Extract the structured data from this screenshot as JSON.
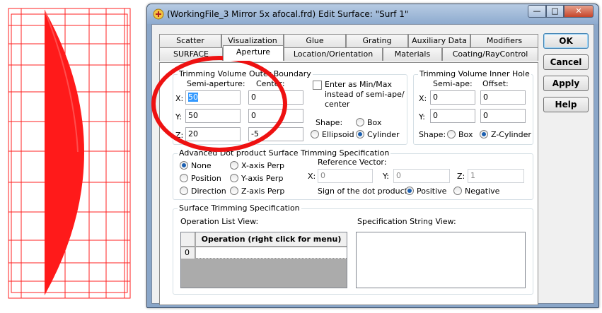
{
  "window": {
    "title": "(WorkingFile_3 Mirror 5x afocal.frd) Edit Surface: \"Surf 1\"",
    "minimize_glyph": "—",
    "maximize_glyph": "□",
    "close_glyph": "✕"
  },
  "tabs": {
    "row1": [
      "Scatter",
      "Visualization",
      "Glue",
      "Grating",
      "Auxiliary Data",
      "Modifiers"
    ],
    "row2": [
      "SURFACE",
      "Aperture",
      "Location/Orientation",
      "Materials",
      "Coating/RayControl"
    ],
    "active": "Aperture"
  },
  "outer": {
    "title": "Trimming Volume Outer Boundary",
    "semi_aperture_label": "Semi-aperture:",
    "center_label": "Center:",
    "axes": [
      {
        "axis": "X:",
        "semi": "50",
        "center": "0"
      },
      {
        "axis": "Y:",
        "semi": "50",
        "center": "0"
      },
      {
        "axis": "Z:",
        "semi": "20",
        "center": "-5"
      }
    ],
    "minmax_line1": "Enter as Min/Max",
    "minmax_line2": "instead of semi-ape/",
    "minmax_line3": "center",
    "shape_label": "Shape:",
    "shape_box": "Box",
    "shape_ellipsoid": "Ellipsoid",
    "shape_cylinder": "Cylinder",
    "shape_selected": "Cylinder"
  },
  "inner": {
    "title": "Trimming Volume Inner Hole",
    "semi_label": "Semi-ape:",
    "offset_label": "Offset:",
    "axes": [
      {
        "axis": "X:",
        "semi": "0",
        "offset": "0"
      },
      {
        "axis": "Y:",
        "semi": "0",
        "offset": "0"
      }
    ],
    "shape_label": "Shape:",
    "shape_box": "Box",
    "shape_zcyl": "Z-Cylinder",
    "shape_selected": "Z-Cylinder"
  },
  "dot": {
    "title": "Advanced Dot product Surface Trimming Specification",
    "options_left": [
      "None",
      "Position",
      "Direction"
    ],
    "options_right": [
      "X-axis Perp",
      "Y-axis Perp",
      "Z-axis Perp"
    ],
    "selected": "None",
    "ref_label": "Reference Vector:",
    "x_label": "X:",
    "x_value": "0",
    "y_label": "Y:",
    "y_value": "0",
    "z_label": "Z:",
    "z_value": "1",
    "sign_label": "Sign of the dot product:",
    "positive": "Positive",
    "negative": "Negative",
    "sign_selected": "Positive"
  },
  "trim": {
    "title": "Surface Trimming Specification",
    "oplist_label": "Operation List View:",
    "spec_label": "Specification String View:",
    "column_header": "Operation (right click for menu)",
    "rows": [
      "0"
    ]
  },
  "buttons": {
    "ok": "OK",
    "cancel": "Cancel",
    "apply": "Apply",
    "help": "Help"
  },
  "colors": {
    "accent_red": "#ee1111",
    "wire_red": "#ff2020",
    "lens_red": "#ff1a1a"
  }
}
